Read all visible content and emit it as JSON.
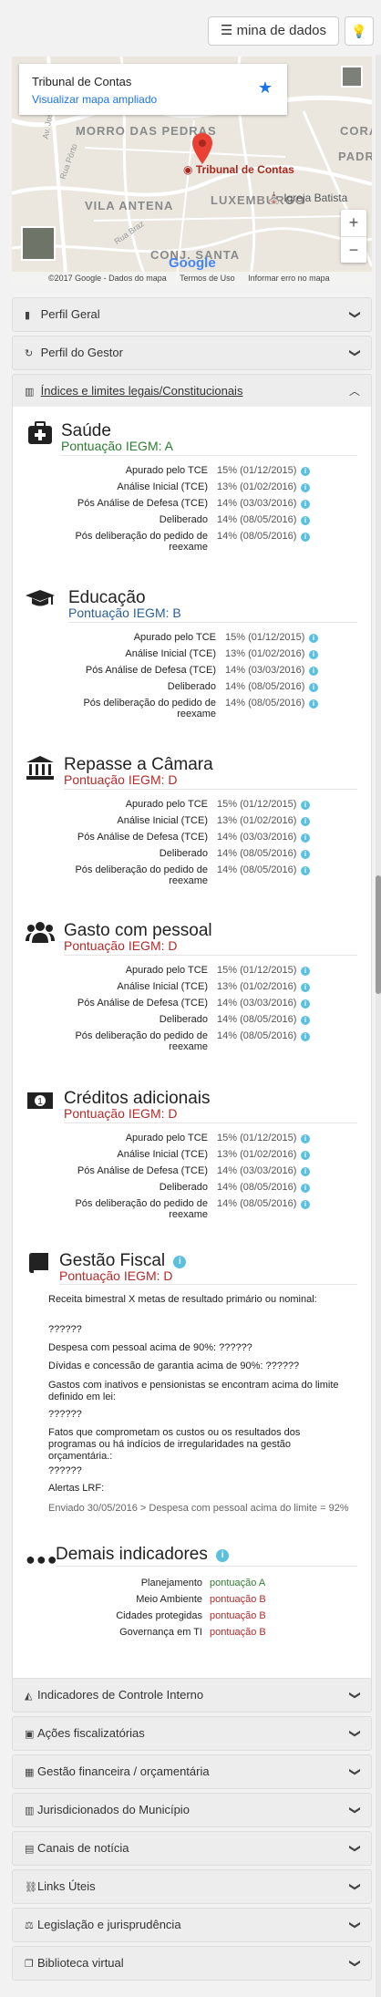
{
  "toolbar": {
    "mina_label": "mina de dados",
    "mina_icon": "menu-icon",
    "bulb_icon": "lightbulb-icon"
  },
  "map": {
    "card_title": "Tribunal de Contas",
    "card_link": "Visualizar mapa ampliado",
    "areas": [
      "MORRO DAS PEDRAS",
      "VILA ANTENA",
      "LUXEMBURGO",
      "CONJ. SANTA",
      "CORA",
      "PADRE"
    ],
    "pin_label": "Tribunal de Contas",
    "poi": "Igreja Batista",
    "streets": [
      "Rua Pôrto",
      "Rua Braz",
      "Av. José Costa"
    ],
    "zoom_in": "+",
    "zoom_out": "−",
    "google": "Google",
    "footer": [
      "©2017 Google - Dados do mapa",
      "Termos de Uso",
      "Informar erro no mapa"
    ]
  },
  "accordion_top": [
    {
      "icon": "building-icon",
      "label": "Perfil Geral"
    },
    {
      "icon": "history-icon",
      "label": "Perfil do Gestor"
    },
    {
      "icon": "bar-chart-icon",
      "label": "Índices e limites legais/Constitucionais"
    }
  ],
  "row_labels": [
    "Apurado pelo TCE",
    "Análise Inicial (TCE)",
    "Pós Análise de Defesa (TCE)",
    "Deliberado",
    "Pós deliberação do pedido de reexame"
  ],
  "sections": [
    {
      "title": "Saúde",
      "score": "Pontuação IEGM: A",
      "icon": "medkit-icon",
      "values": [
        "15% (01/12/2015)",
        "13% (01/02/2016)",
        "14% (03/03/2016)",
        "14% (08/05/2016)",
        "14% (08/05/2016)"
      ]
    },
    {
      "title": "Educação",
      "score": "Pontuação IEGM: B",
      "icon": "graduation-cap-icon",
      "values": [
        "15% (01/12/2015)",
        "13% (01/02/2016)",
        "14% (03/03/2016)",
        "14% (08/05/2016)",
        "14% (08/05/2016)"
      ]
    },
    {
      "title": "Repasse a Câmara",
      "score": "Pontuação IEGM: D",
      "icon": "bank-icon",
      "values": [
        "15% (01/12/2015)",
        "13% (01/02/2016)",
        "14% (03/03/2016)",
        "14% (08/05/2016)",
        "14% (08/05/2016)"
      ]
    },
    {
      "title": "Gasto com pessoal",
      "score": "Pontuação IEGM: D",
      "icon": "users-icon",
      "values": [
        "15% (01/12/2015)",
        "13% (01/02/2016)",
        "14% (03/03/2016)",
        "14% (08/05/2016)",
        "14% (08/05/2016)"
      ]
    },
    {
      "title": "Créditos adicionais",
      "score": "Pontuação IEGM: D",
      "icon": "money-icon",
      "values": [
        "15% (01/12/2015)",
        "13% (01/02/2016)",
        "14% (03/03/2016)",
        "14% (08/05/2016)",
        "14% (08/05/2016)"
      ]
    }
  ],
  "fiscal": {
    "title": "Gestão Fiscal",
    "score": "Pontuação IEGM: D",
    "icon": "book-icon",
    "lines": [
      "Receita bimestral X metas de resultado primário ou nominal:",
      "??????",
      "Despesa com pessoal acima de 90%: ??????",
      "Dívidas e concessão de garantia acima de 90%: ??????",
      "Gastos com inativos e pensionistas se encontram acima do limite definido em lei:",
      "??????",
      "Fatos que comprometam os custos ou os resultados dos programas ou há indícios de irregularidades na gestão orçamentária.:",
      "??????",
      "Alertas LRF:",
      "Enviado 30/05/2016 > Despesa com pessoal acima do limite = 92%"
    ]
  },
  "demais": {
    "title": "Demais indicadores",
    "icon": "ellipsis-icon",
    "rows": [
      {
        "label": "Planejamento",
        "value": "pontuação A"
      },
      {
        "label": "Meio Ambiente",
        "value": "pontuação B"
      },
      {
        "label": "Cidades protegidas",
        "value": "pontuação B"
      },
      {
        "label": "Governança em TI",
        "value": "pontuação B"
      }
    ]
  },
  "accordion_bottom": [
    {
      "icon": "area-chart-icon",
      "label": "Indicadores de Controle Interno"
    },
    {
      "icon": "briefcase-icon",
      "label": "Ações fiscalizatórias"
    },
    {
      "icon": "calculator-icon",
      "label": "Gestão financeira / orçamentária"
    },
    {
      "icon": "bar-chart-icon",
      "label": "Jurisdicionados do Município"
    },
    {
      "icon": "newspaper-icon",
      "label": "Canais de notícia"
    },
    {
      "icon": "link-icon",
      "label": "Links Úteis"
    },
    {
      "icon": "legal-icon",
      "label": "Legislação e jurisprudência"
    },
    {
      "icon": "copy-icon",
      "label": "Biblioteca virtual"
    }
  ],
  "colors": {
    "green": "#2f7d32",
    "blue": "#2a5e99",
    "red": "#b52a2a",
    "info": "#5bc0de"
  }
}
